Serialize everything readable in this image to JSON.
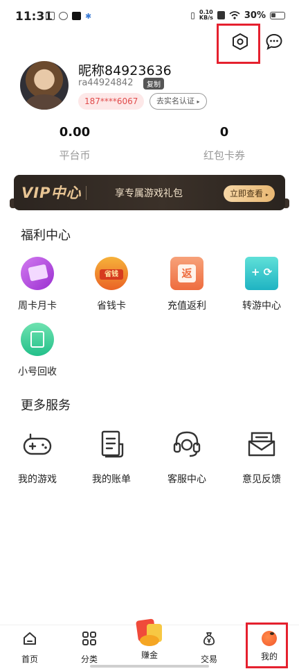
{
  "status_bar": {
    "time": "11:31",
    "net_speed_value": "0.10",
    "net_speed_unit": "KB/s",
    "battery": "30%"
  },
  "profile": {
    "nickname": "昵称84923636",
    "user_id": "ra44924842",
    "copy_label": "复制",
    "phone": "187****6067",
    "realname_label": "去实名认证"
  },
  "balances": [
    {
      "value": "0.00",
      "label": "平台币"
    },
    {
      "value": "0",
      "label": "红包卡券"
    }
  ],
  "vip_banner": {
    "logo": "VIP中心",
    "text": "享专属游戏礼包",
    "button": "立即查看"
  },
  "welfare": {
    "title": "福利中心",
    "items": [
      {
        "label": "周卡月卡",
        "icon": "weekly-card-icon",
        "color": "#b04ad8"
      },
      {
        "label": "省钱卡",
        "icon": "save-money-card-icon",
        "color": "#f0822a"
      },
      {
        "label": "充值返利",
        "icon": "recharge-rebate-icon",
        "color": "#f28c5a"
      },
      {
        "label": "转游中心",
        "icon": "transfer-game-icon",
        "color": "#2fc4c8"
      },
      {
        "label": "小号回收",
        "icon": "account-recycle-icon",
        "color": "#34c98a"
      }
    ]
  },
  "services": {
    "title": "更多服务",
    "items": [
      {
        "label": "我的游戏",
        "icon": "gamepad-icon"
      },
      {
        "label": "我的账单",
        "icon": "bill-icon"
      },
      {
        "label": "客服中心",
        "icon": "headset-icon"
      },
      {
        "label": "意见反馈",
        "icon": "feedback-icon"
      }
    ]
  },
  "nav": {
    "items": [
      {
        "label": "首页",
        "icon": "home-icon"
      },
      {
        "label": "分类",
        "icon": "category-icon"
      },
      {
        "label": "赚金",
        "icon": "earn-gold-icon"
      },
      {
        "label": "交易",
        "icon": "money-bag-icon"
      },
      {
        "label": "我的",
        "icon": "profile-dot-icon"
      }
    ],
    "active_color": "#f2572b"
  },
  "colors": {
    "highlight": "#e5202e",
    "phone_text": "#e14b4b",
    "vip_gold": "#e8c594"
  }
}
